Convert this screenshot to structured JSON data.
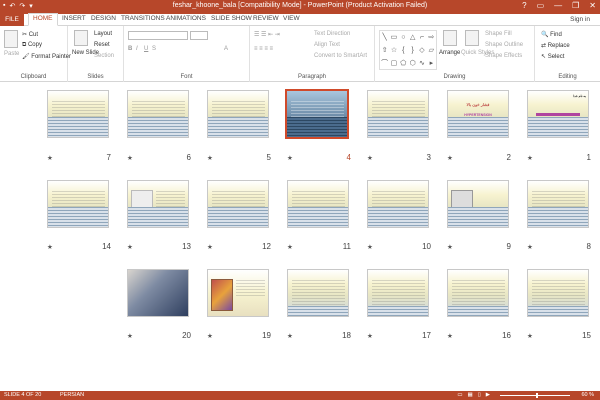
{
  "window": {
    "title": "feshar_khoone_bala [Compatibility Mode] - PowerPoint (Product Activation Failed)",
    "qa_icons": [
      "save-icon",
      "undo-icon",
      "redo-icon",
      "customize-icon"
    ],
    "controls": [
      "?",
      "▭",
      "—",
      "❐",
      "✕"
    ]
  },
  "tabs": [
    "FILE",
    "HOME",
    "INSERT",
    "DESIGN",
    "TRANSITIONS",
    "ANIMATIONS",
    "SLIDE SHOW",
    "REVIEW",
    "VIEW"
  ],
  "active_tab": "HOME",
  "signin": "Sign in",
  "ribbon": {
    "clipboard": {
      "label": "Clipboard",
      "paste": "Paste",
      "cut": "Cut",
      "copy": "Copy",
      "format_painter": "Format Painter"
    },
    "slides": {
      "label": "Slides",
      "new_slide": "New Slide",
      "layout": "Layout",
      "reset": "Reset",
      "section": "Section"
    },
    "font": {
      "label": "Font"
    },
    "paragraph": {
      "label": "Paragraph",
      "text_direction": "Text Direction",
      "align_text": "Align Text",
      "convert": "Convert to SmartArt"
    },
    "drawing": {
      "label": "Drawing",
      "arrange": "Arrange",
      "quick_styles": "Quick Styles",
      "shape_fill": "Shape Fill",
      "shape_outline": "Shape Outline",
      "shape_effects": "Shape Effects"
    },
    "editing": {
      "label": "Editing",
      "find": "Find",
      "replace": "Replace",
      "select": "Select"
    }
  },
  "slides": [
    {
      "n": "1"
    },
    {
      "n": "2"
    },
    {
      "n": "3"
    },
    {
      "n": "4"
    },
    {
      "n": "5"
    },
    {
      "n": "6"
    },
    {
      "n": "7"
    },
    {
      "n": "8"
    },
    {
      "n": "9"
    },
    {
      "n": "10"
    },
    {
      "n": "11"
    },
    {
      "n": "12"
    },
    {
      "n": "13"
    },
    {
      "n": "14"
    },
    {
      "n": "15"
    },
    {
      "n": "16"
    },
    {
      "n": "17"
    },
    {
      "n": "18"
    },
    {
      "n": "19"
    },
    {
      "n": "20"
    }
  ],
  "slide2_text": {
    "title": "فشار خون بالا",
    "subtitle": "HYPERTENSION"
  },
  "slide1_text": {
    "title": "به نام خدا"
  },
  "status": {
    "slide": "SLIDE 4 OF 20",
    "language": "PERSIAN",
    "zoom": "60 %"
  }
}
